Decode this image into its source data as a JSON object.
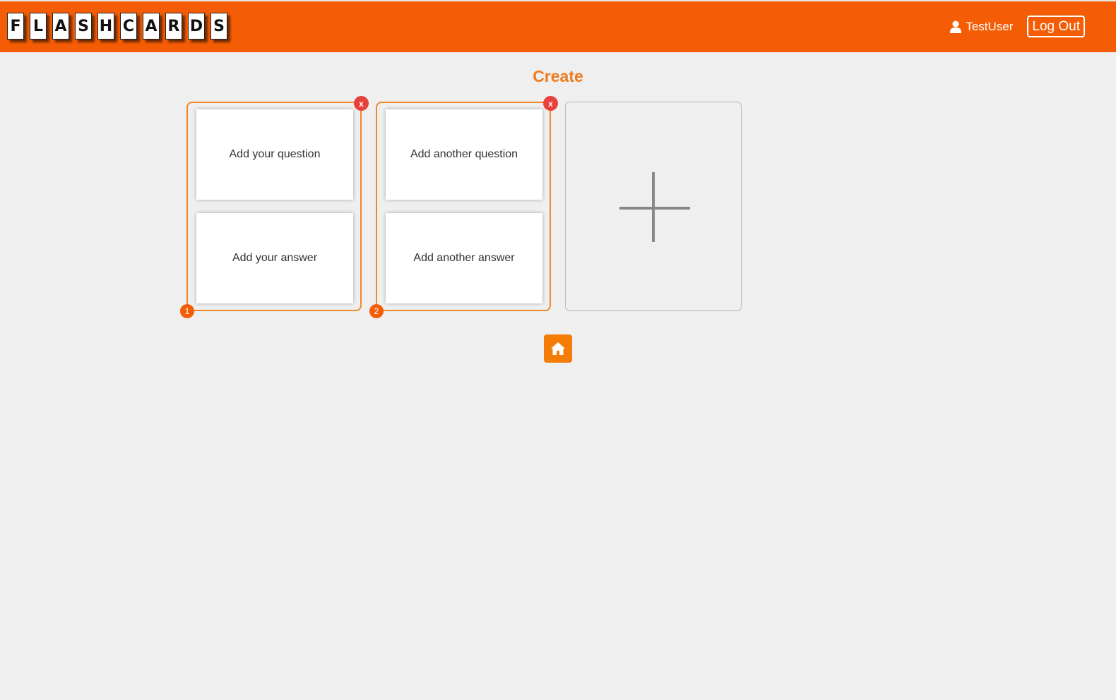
{
  "header": {
    "logo_letters": [
      "F",
      "L",
      "A",
      "S",
      "H",
      "C",
      "A",
      "R",
      "D",
      "S"
    ],
    "username": "TestUser",
    "logout_label": "Log Out"
  },
  "main": {
    "title": "Create",
    "cards": [
      {
        "number": "1",
        "question": "Add your question",
        "answer": "Add your answer",
        "remove_label": "x"
      },
      {
        "number": "2",
        "question": "Add another question",
        "answer": "Add another answer",
        "remove_label": "x"
      }
    ]
  },
  "colors": {
    "brand": "#f45d05",
    "title": "#ee7b1f",
    "card_border": "#ee8a2a",
    "remove": "#e8403a",
    "background": "#efefef"
  },
  "icons": {
    "user": "user-icon",
    "add_card": "plus-icon",
    "home": "home-icon"
  }
}
